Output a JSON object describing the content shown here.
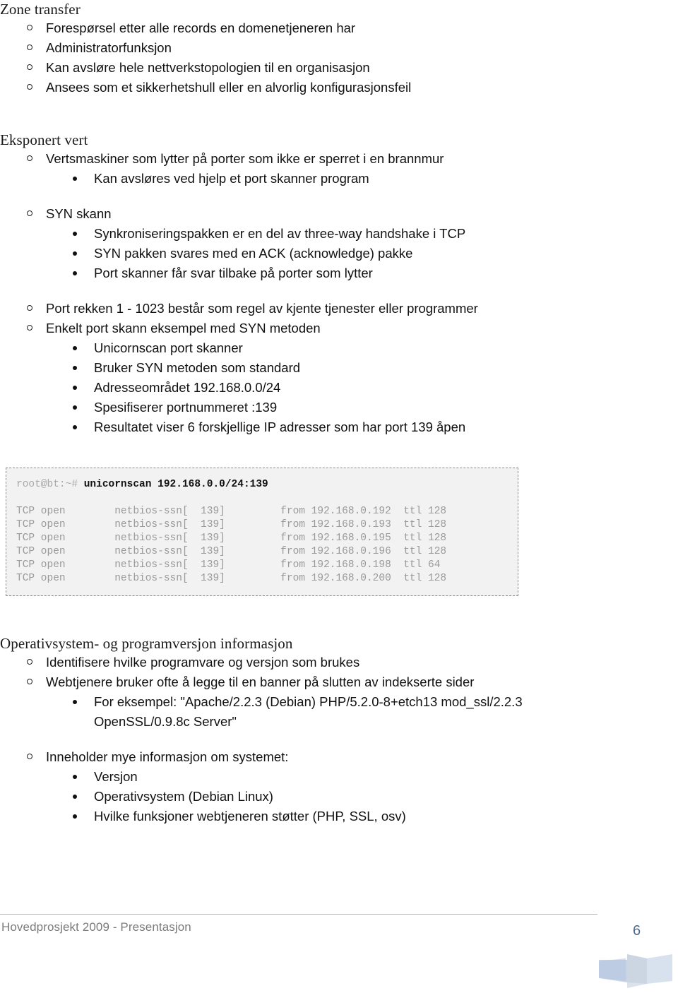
{
  "document": {
    "title": "Hovedprosjekt 2009 - Presentasjon",
    "page_number": "6"
  },
  "sections": [
    {
      "heading": "Zone transfer",
      "items": [
        {
          "level": 1,
          "text": "Forespørsel etter alle records en domenetjeneren har"
        },
        {
          "level": 1,
          "text": "Administratorfunksjon"
        },
        {
          "level": 1,
          "text": "Kan avsløre hele nettverkstopologien til en organisasjon"
        },
        {
          "level": 1,
          "text": "Ansees som et sikkerhetshull eller en alvorlig konfigurasjonsfeil"
        }
      ]
    },
    {
      "heading": "Eksponert vert",
      "items": [
        {
          "level": 1,
          "text": "Vertsmaskiner som lytter på porter som ikke er sperret i en brannmur"
        },
        {
          "level": 2,
          "text": "Kan avsløres ved hjelp et port skanner program"
        },
        {
          "level": 1,
          "text": "SYN skann"
        },
        {
          "level": 2,
          "text": "Synkroniseringspakken er en del av three-way handshake i TCP"
        },
        {
          "level": 2,
          "text": "SYN pakken svares med en ACK (acknowledge) pakke"
        },
        {
          "level": 2,
          "text": "Port skanner får svar tilbake på porter som lytter"
        },
        {
          "level": 1,
          "text": "Port rekken 1 - 1023 består som regel av kjente tjenester eller programmer"
        },
        {
          "level": 1,
          "text": "Enkelt port skann eksempel med SYN metoden"
        },
        {
          "level": 2,
          "text": "Unicornscan port skanner"
        },
        {
          "level": 2,
          "text": "Bruker SYN metoden som standard"
        },
        {
          "level": 2,
          "text": "Adresseområdet 192.168.0.0/24"
        },
        {
          "level": 2,
          "text": "Spesifiserer portnummeret :139"
        },
        {
          "level": 2,
          "text": "Resultatet viser 6 forskjellige IP adresser som har port 139 åpen"
        }
      ]
    },
    {
      "heading": "Operativsystem- og programversjon informasjon",
      "items": [
        {
          "level": 1,
          "text": "Identifisere hvilke programvare og versjon som brukes"
        },
        {
          "level": 1,
          "text": "Webtjenere bruker ofte å legge til en banner på slutten av indekserte sider"
        },
        {
          "level": 2,
          "text": "For eksempel: \"Apache/2.2.3 (Debian) PHP/5.2.0-8+etch13 mod_ssl/2.2.3",
          "text_cont": "OpenSSL/0.9.8c Server\""
        },
        {
          "level": 1,
          "text": "Inneholder mye informasjon om systemet:"
        },
        {
          "level": 2,
          "text": "Versjon"
        },
        {
          "level": 2,
          "text": "Operativsystem (Debian Linux)"
        },
        {
          "level": 2,
          "text": "Hvilke funksjoner webtjeneren støtter (PHP, SSL, osv)"
        }
      ]
    }
  ],
  "terminal": {
    "prompt": "root@bt:~# ",
    "command": "unicornscan 192.168.0.0/24:139",
    "rows": [
      "TCP open        netbios-ssn[  139]         from 192.168.0.192  ttl 128",
      "TCP open        netbios-ssn[  139]         from 192.168.0.193  ttl 128",
      "TCP open        netbios-ssn[  139]         from 192.168.0.195  ttl 128",
      "TCP open        netbios-ssn[  139]         from 192.168.0.196  ttl 128",
      "TCP open        netbios-ssn[  139]         from 192.168.0.198  ttl 64",
      "TCP open        netbios-ssn[  139]         from 192.168.0.200  ttl 128"
    ]
  },
  "colors": {
    "page_number": "#4d6a8c",
    "footer_text": "#7b7b7b",
    "terminal_bg": "#f2f2f2",
    "terminal_border": "#8c8c8c",
    "terminal_output": "#9a9a9a",
    "logo_blue": "#b6c7e0"
  }
}
